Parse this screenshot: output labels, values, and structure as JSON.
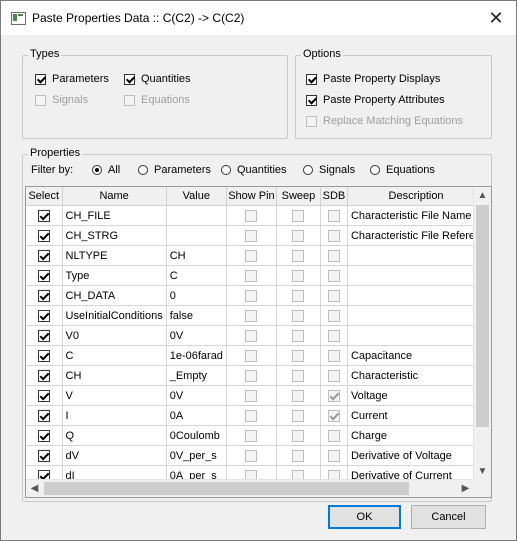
{
  "window": {
    "title": "Paste Properties Data :: C(C2) -> C(C2)",
    "close_glyph": "✕"
  },
  "types": {
    "legend": "Types",
    "items": [
      {
        "label": "Parameters",
        "checked": true,
        "enabled": true
      },
      {
        "label": "Quantities",
        "checked": true,
        "enabled": true
      },
      {
        "label": "Signals",
        "checked": false,
        "enabled": false
      },
      {
        "label": "Equations",
        "checked": false,
        "enabled": false
      }
    ]
  },
  "options": {
    "legend": "Options",
    "items": [
      {
        "label": "Paste Property Displays",
        "checked": true,
        "enabled": true
      },
      {
        "label": "Paste Property Attributes",
        "checked": true,
        "enabled": true
      },
      {
        "label": "Replace Matching Equations",
        "checked": false,
        "enabled": false
      }
    ]
  },
  "properties": {
    "legend": "Properties",
    "filter_label": "Filter by:",
    "filters": [
      {
        "label": "All",
        "selected": true
      },
      {
        "label": "Parameters",
        "selected": false
      },
      {
        "label": "Quantities",
        "selected": false
      },
      {
        "label": "Signals",
        "selected": false
      },
      {
        "label": "Equations",
        "selected": false
      }
    ],
    "columns": [
      "Select",
      "Name",
      "Value",
      "Show Pin",
      "Sweep",
      "SDB",
      "Description"
    ],
    "rows": [
      {
        "select": true,
        "name": "CH_FILE",
        "value": "",
        "show_pin": false,
        "sweep": false,
        "sdb": false,
        "description": "Characteristic File Name"
      },
      {
        "select": true,
        "name": "CH_STRG",
        "value": "",
        "show_pin": false,
        "sweep": false,
        "sdb": false,
        "description": "Characteristic File Referen"
      },
      {
        "select": true,
        "name": "NLTYPE",
        "value": "CH",
        "show_pin": false,
        "sweep": false,
        "sdb": false,
        "description": ""
      },
      {
        "select": true,
        "name": "Type",
        "value": "C",
        "show_pin": false,
        "sweep": false,
        "sdb": false,
        "description": ""
      },
      {
        "select": true,
        "name": "CH_DATA",
        "value": "0",
        "show_pin": false,
        "sweep": false,
        "sdb": false,
        "description": ""
      },
      {
        "select": true,
        "name": "UseInitialConditions",
        "value": "false",
        "show_pin": false,
        "sweep": false,
        "sdb": false,
        "description": ""
      },
      {
        "select": true,
        "name": "V0",
        "value": "0V",
        "show_pin": false,
        "sweep": false,
        "sdb": false,
        "description": ""
      },
      {
        "select": true,
        "name": "C",
        "value": "1e-06farad",
        "show_pin": false,
        "sweep": false,
        "sdb": false,
        "description": "Capacitance"
      },
      {
        "select": true,
        "name": "CH",
        "value": "_Empty",
        "show_pin": false,
        "sweep": false,
        "sdb": false,
        "description": "Characteristic"
      },
      {
        "select": true,
        "name": "V",
        "value": "0V",
        "show_pin": false,
        "sweep": false,
        "sdb": true,
        "description": "Voltage"
      },
      {
        "select": true,
        "name": "I",
        "value": "0A",
        "show_pin": false,
        "sweep": false,
        "sdb": true,
        "description": "Current"
      },
      {
        "select": true,
        "name": "Q",
        "value": "0Coulomb",
        "show_pin": false,
        "sweep": false,
        "sdb": false,
        "description": "Charge"
      },
      {
        "select": true,
        "name": "dV",
        "value": "0V_per_s",
        "show_pin": false,
        "sweep": false,
        "sdb": false,
        "description": "Derivative of Voltage"
      },
      {
        "select": true,
        "name": "dI",
        "value": "0A_per_s",
        "show_pin": false,
        "sweep": false,
        "sdb": false,
        "description": "Derivative of Current"
      }
    ]
  },
  "scroll_arrows": {
    "up": "▲",
    "down": "▼",
    "left": "◀",
    "right": "▶"
  },
  "buttons": {
    "ok": "OK",
    "cancel": "Cancel"
  }
}
